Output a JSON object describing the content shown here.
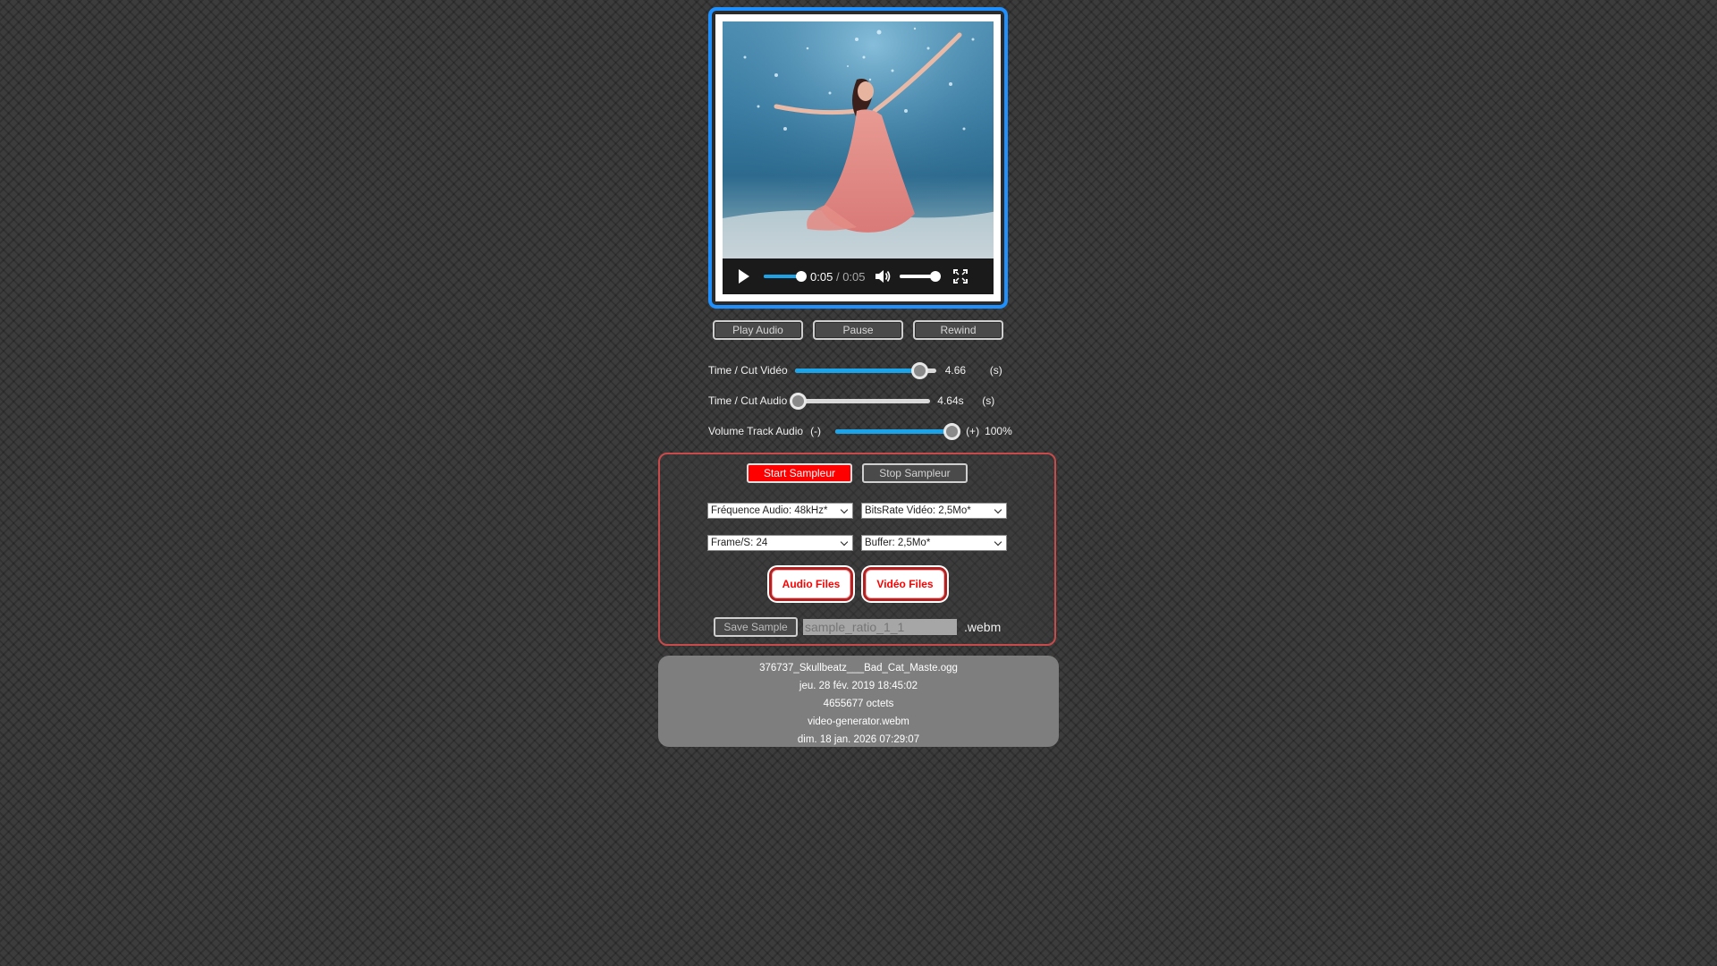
{
  "player": {
    "current_time": "0:05",
    "separator": "/",
    "duration": "0:05",
    "progress": 1.0,
    "volume": 1.0,
    "frame_color": "#1e90ff",
    "icons": {
      "play": "play-icon",
      "volume": "volume-icon",
      "fullscreen": "fullscreen-icon"
    }
  },
  "transport": {
    "play_label": "Play Audio",
    "pause_label": "Pause",
    "rewind_label": "Rewind"
  },
  "sliders": {
    "video_cut": {
      "label": "Time  / Cut Vidéo",
      "value_text": "4.66",
      "unit": "(s)",
      "position": 0.88
    },
    "audio_cut": {
      "label": "Time  / Cut Audio",
      "value_text": "4.64s",
      "unit": "(s)",
      "position": 0.0
    },
    "volume": {
      "label": "Volume Track Audio",
      "minus": "(-)",
      "plus": "(+)",
      "value_text": "100%",
      "position": 1.0
    }
  },
  "sampler": {
    "start_label": "Start Sampleur",
    "stop_label": "Stop Sampleur",
    "audio_freq": "Fréquence Audio: 48kHz*",
    "bitrate": "BitsRate Vidéo: 2,5Mo*",
    "fps": "Frame/S: 24",
    "buffer": "Buffer: 2,5Mo*",
    "audio_files_label": "Audio Files",
    "video_files_label": "Vidéo Files",
    "save_label": "Save Sample",
    "filename_placeholder": "sample_ratio_1_1",
    "extension": ".webm",
    "accent_color": "#ff0000"
  },
  "info": {
    "audio_name": "376737_Skullbeatz___Bad_Cat_Maste.ogg",
    "audio_date": "jeu. 28 fév. 2019 18:45:02",
    "audio_size": "4655677 octets",
    "video_name": "video-generator.webm",
    "video_date": "dim. 18 jan. 2026 07:29:07"
  }
}
